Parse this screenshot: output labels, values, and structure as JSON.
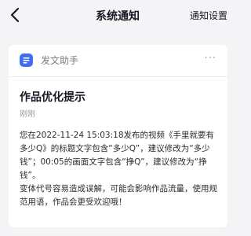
{
  "header": {
    "title": "系统通知",
    "settings_label": "通知设置"
  },
  "card": {
    "app_name": "发文助手",
    "more": "···",
    "notice_title": "作品优化提示",
    "time": "刚刚",
    "paragraph1": "您在2022-11-24 15:03:18发布的视频《手里就要有多少Q》的标题文字包含“多少Q”，建议修改为“多少钱”；00:05的画面文字包含“挣Q”，建议修改为“挣钱”。",
    "paragraph2": "变体代号容易造成误解，可能会影响作品流量，使用规范用语，作品会更受欢迎哦！"
  },
  "colors": {
    "background": "#f4f4f6",
    "card": "#ffffff",
    "accent": "#3d6ef5",
    "secondary_text": "#9a9ba0"
  },
  "icons": {
    "back": "chevron-left-icon",
    "app": "document-icon",
    "more": "more-dots-icon"
  }
}
